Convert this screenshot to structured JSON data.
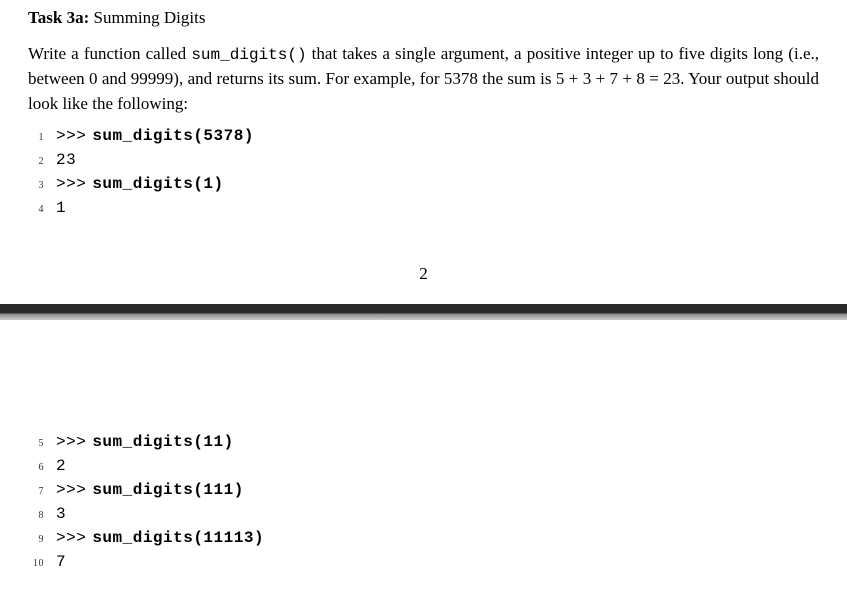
{
  "heading": {
    "bold": "Task 3a:",
    "rest": " Summing Digits"
  },
  "description": {
    "pre_fn": "Write a function called ",
    "fn_name": "sum_digits()",
    "post_fn": " that takes a single argument, a positive integer up to five digits long (i.e., between 0 and 99999), and returns its sum.  For example, for 5378 the sum is 5 + 3 + 7 + 8 = 23. Your output should look like the following:"
  },
  "code_top": [
    {
      "lineno": "1",
      "prompt": ">>>",
      "fn": "sum_digits(5378)"
    },
    {
      "lineno": "2",
      "output": "23"
    },
    {
      "lineno": "3",
      "prompt": ">>>",
      "fn": "sum_digits(1)"
    },
    {
      "lineno": "4",
      "output": "1"
    }
  ],
  "page_number": "2",
  "code_bottom": [
    {
      "lineno": "5",
      "prompt": ">>>",
      "fn": "sum_digits(11)"
    },
    {
      "lineno": "6",
      "output": "2"
    },
    {
      "lineno": "7",
      "prompt": ">>>",
      "fn": "sum_digits(111)"
    },
    {
      "lineno": "8",
      "output": "3"
    },
    {
      "lineno": "9",
      "prompt": ">>>",
      "fn": "sum_digits(11113)"
    },
    {
      "lineno": "10",
      "output": "7"
    }
  ]
}
